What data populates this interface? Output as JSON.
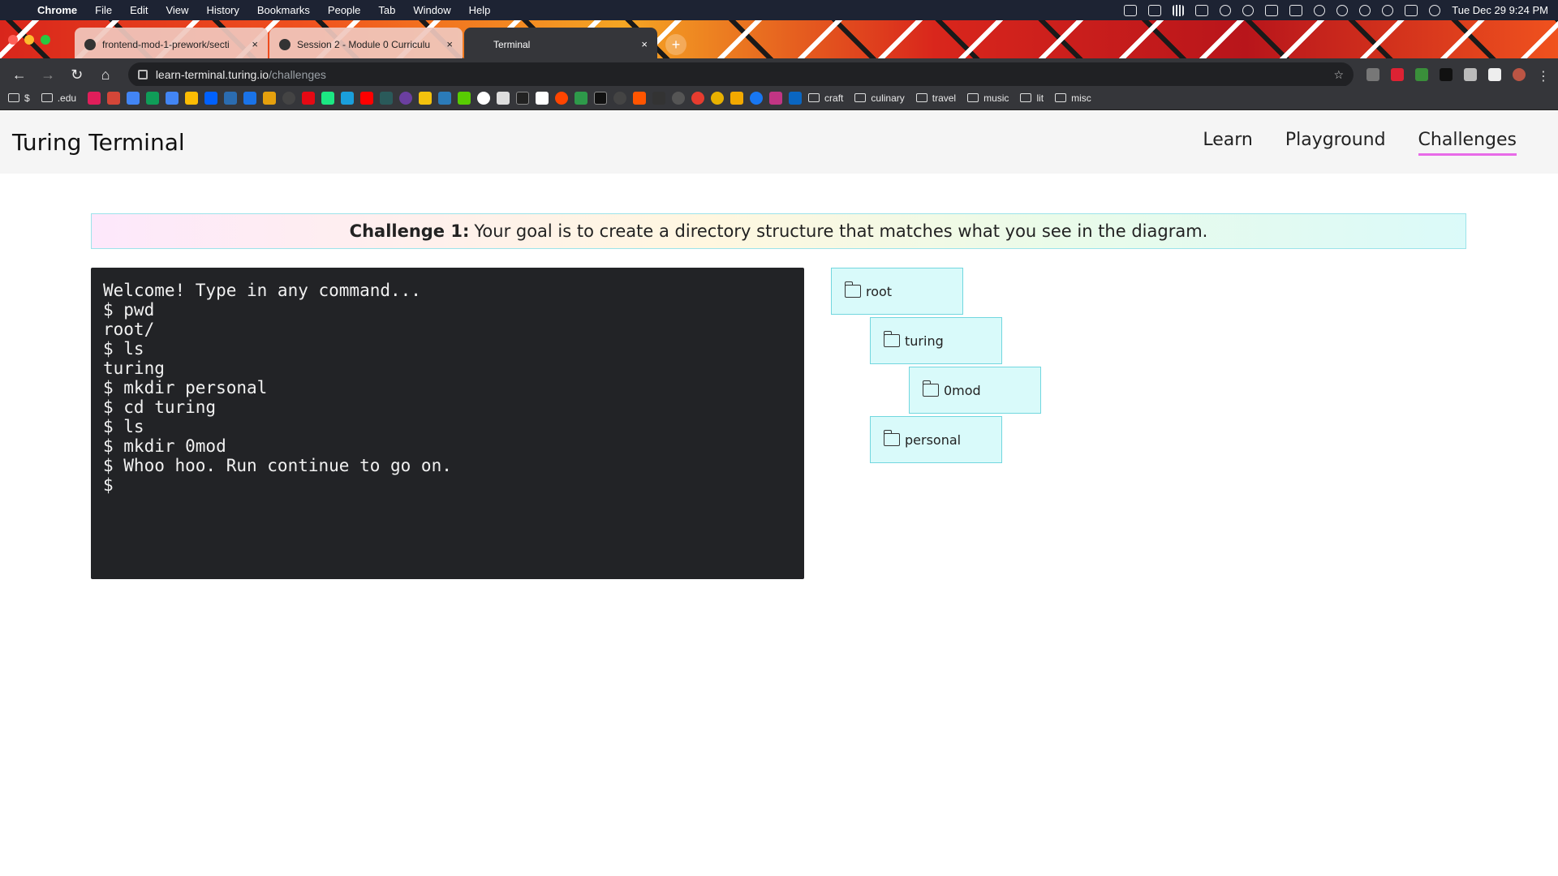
{
  "menubar": {
    "app": "Chrome",
    "items": [
      "File",
      "Edit",
      "View",
      "History",
      "Bookmarks",
      "People",
      "Tab",
      "Window",
      "Help"
    ],
    "clock": "Tue Dec 29  9:24 PM"
  },
  "tabs": [
    {
      "title": "frontend-mod-1-prework/secti",
      "close": "×"
    },
    {
      "title": "Session 2 - Module 0 Curriculu",
      "close": "×"
    },
    {
      "title": "Terminal",
      "close": "×"
    }
  ],
  "newtab": "+",
  "address": {
    "host": "learn-terminal.turing.io",
    "path": "/challenges"
  },
  "bookmarks": {
    "leading": [
      {
        "label": "$"
      },
      {
        "label": ".edu"
      }
    ],
    "folders": [
      "craft",
      "culinary",
      "travel",
      "music",
      "lit",
      "misc"
    ]
  },
  "site": {
    "title": "Turing Terminal",
    "nav": [
      "Learn",
      "Playground",
      "Challenges"
    ]
  },
  "challenge": {
    "label": "Challenge 1:",
    "text": "Your goal is to create a directory structure that matches what you see in the diagram."
  },
  "terminal": {
    "lines": [
      "Welcome! Type in any command...",
      "$ pwd",
      "root/",
      "$ ls",
      "turing",
      "$ mkdir personal",
      "$ cd turing",
      "$ ls",
      "$ mkdir 0mod",
      "$ Whoo hoo. Run continue to go on.",
      "$"
    ]
  },
  "tree": {
    "nodes": [
      {
        "name": "root",
        "depth": 0
      },
      {
        "name": "turing",
        "depth": 1
      },
      {
        "name": "0mod",
        "depth": 2
      },
      {
        "name": "personal",
        "depth": 1
      }
    ]
  },
  "colors": {
    "accent_underline": "#e86ae8",
    "node_fill": "#d9fafa",
    "node_border": "#72d7df",
    "terminal_bg": "#222326"
  }
}
